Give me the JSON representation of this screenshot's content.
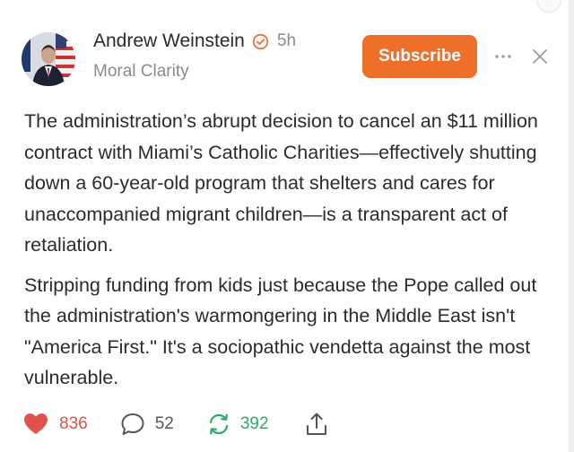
{
  "post": {
    "author_name": "Andrew Weinstein",
    "timestamp": "5h",
    "publication": "Moral Clarity",
    "subscribe_label": "Subscribe",
    "paragraphs": [
      "The administration’s abrupt decision to cancel an $11 million contract with Miami’s Catholic Charities—effectively shutting down a 60-year-old program that shelters and cares for unaccompanied migrant children—is a transparent act of retaliation.",
      "Stripping funding from kids just because the Pope called out the administration's warmongering in the Middle East isn't \"America First.\" It's a sociopathic vendetta against the most vulnerable."
    ]
  },
  "actions": {
    "likes": "836",
    "comments": "52",
    "restacks": "392"
  },
  "icons": {
    "verified": "check-circle-icon",
    "more": "ellipsis-icon",
    "close": "close-icon",
    "like": "heart-icon",
    "comment": "comment-bubble-icon",
    "restack": "restack-icon",
    "share": "share-icon"
  },
  "colors": {
    "accent": "#ee6f2a",
    "like": "#e0524c",
    "restack": "#2ea86b",
    "muted": "#8a8a8a"
  }
}
